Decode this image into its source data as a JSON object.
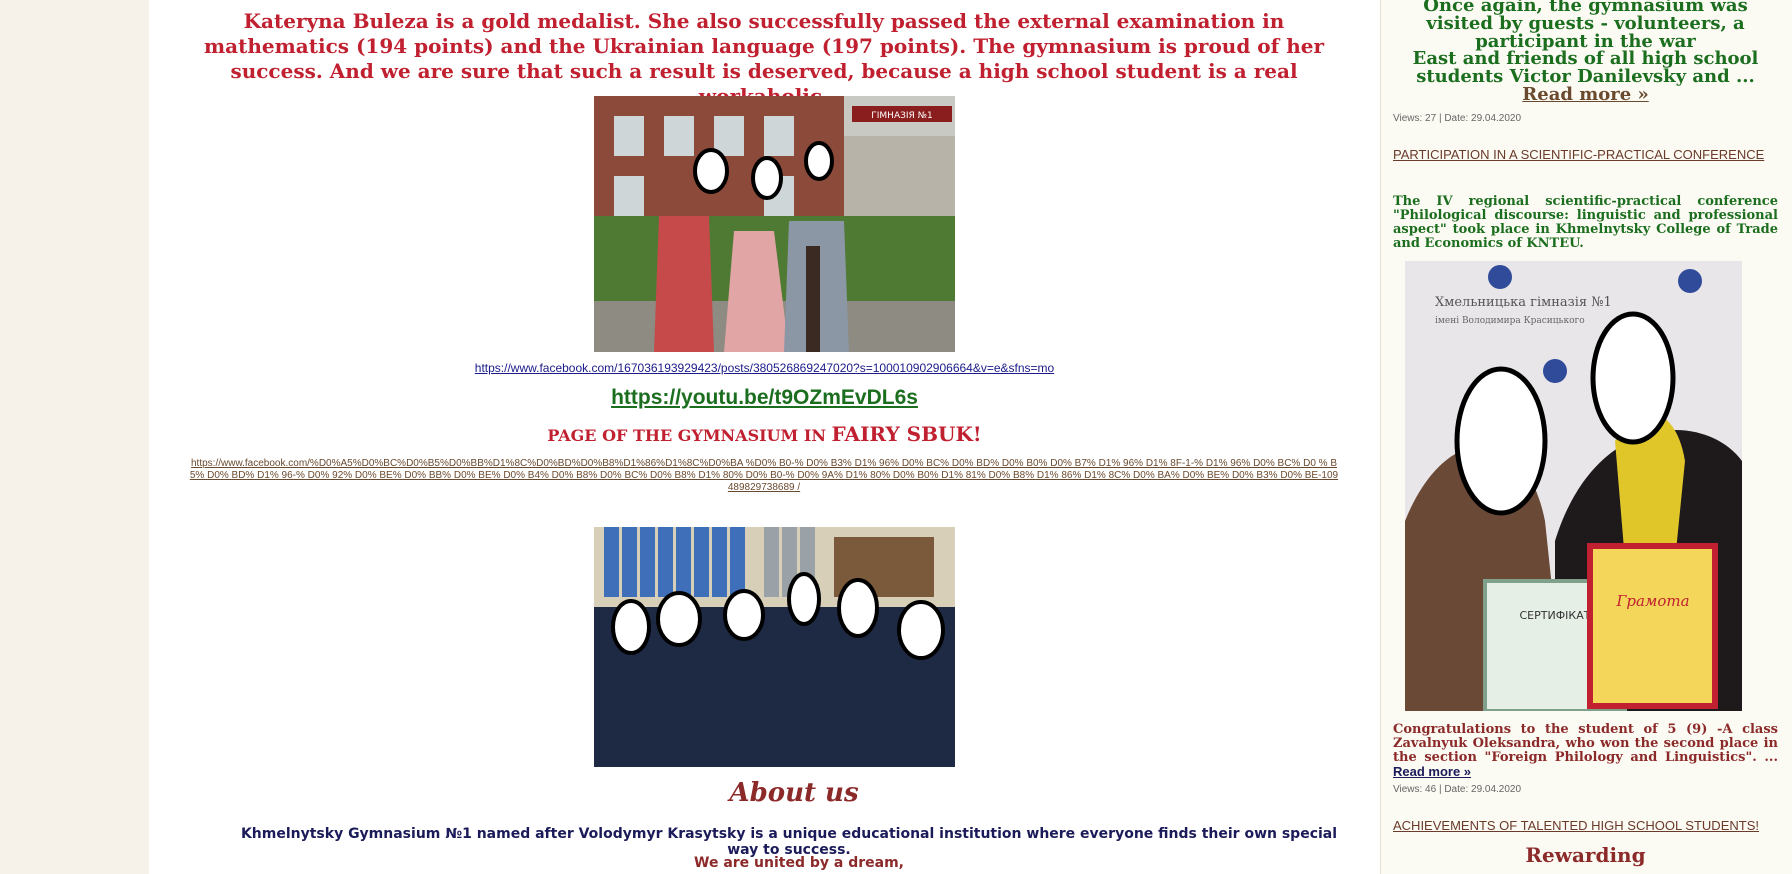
{
  "main": {
    "lead_text": "Kateryna Buleza is a gold medalist. She also successfully passed the external examination in mathematics (194 points) and the Ukrainian language (197 points). The gymnasium is proud of her success. And we are sure that such a result is deserved, because a high school student is a real workaholic.",
    "facebook_link": "https://www.facebook.com/167036193929423/posts/380526869247020?s=100010902906664&v=e&sfns=mo",
    "youtube_link": "https://youtu.be/t9OZmEvDL6s",
    "page_title_prefix": "PAGE OF THE GYMNASIUM IN",
    "page_title_suffix": "FAIRY SBUK!",
    "long_link": "https://www.facebook.com/%D0%A5%D0%BC%D0%B5%D0%BB%D1%8C%D0%BD%D0%B8%D1%86%D1%8C%D0%BA %D0% B0-% D0% B3% D1% 96% D0% BC% D0% BD% D0% B0% D0% B7% D1% 96% D1% 8F-1-% D1% 96% D0% BC% D0 % B5% D0% BD% D1% 96-% D0% 92% D0% BE% D0% BB% D0% BE% D0% B4% D0% B8% D0% BC% D0% B8% D1% 80% D0% B0-% D0% 9A% D1% 80% D0% B0% D1% 81% D0% B8% D1% 86% D1% 8C% D0% BA% D0% BE% D0% B3% D0% BE-109489829738689 /",
    "about_title": "About us",
    "about_text": "Khmelnytsky Gymnasium №1 named after Volodymyr Krasytsky is a unique educational institution where everyone finds their own special way to success.",
    "united_text": "We are united by a dream,",
    "photo1_sign": "ГІМНАЗІЯ №1"
  },
  "side": {
    "head1": "Once again, the gymnasium was visited by guests - volunteers, a participant in the war",
    "head2": "East and friends of all high school students Victor Danilevsky and ...",
    "head2_more": "Read more »",
    "meta1": "Views: 27 | Date: 29.04.2020",
    "link1": "PARTICIPATION IN A SCIENTIFIC-PRACTICAL CONFERENCE",
    "green_text": "The IV regional scientific-practical conference \"Philological discourse: linguistic and professional aspect\" took place in Khmelnytsky College of Trade and Economics of KNTEU.",
    "photo_banner1": "Хмельницька гімназія №1",
    "photo_banner2": "імені Володимира Красицького",
    "photo_cert": "СЕРТИФІКАТ",
    "photo_gramota": "Грамота",
    "red_text": "Congratulations to the student of 5 (9) -A class Zavalnyuk Oleksandra, who won the second place in the section \"Foreign Philology and Linguistics\". ...",
    "red_more": "Read more »",
    "meta2": "Views: 46 | Date: 29.04.2020",
    "link2": "ACHIEVEMENTS OF TALENTED HIGH SCHOOL STUDENTS!",
    "rewarding": "Rewarding"
  }
}
